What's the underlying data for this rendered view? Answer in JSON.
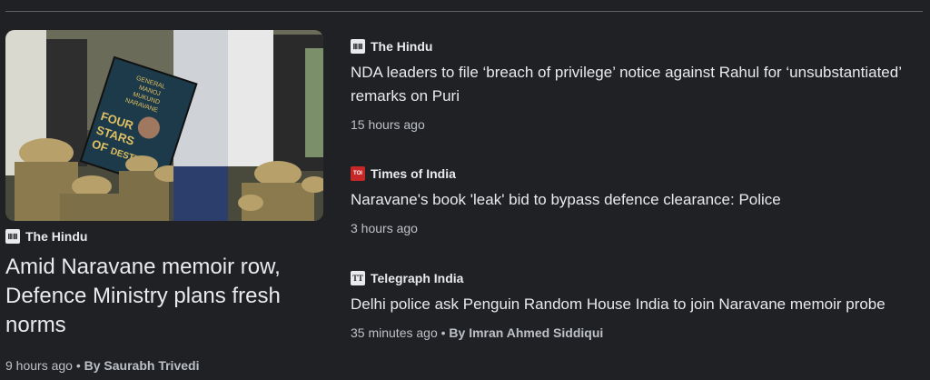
{
  "main_story": {
    "source": "The Hindu",
    "source_icon": "the-hindu-logo-icon",
    "title": "Amid Naravane memoir row, Defence Ministry plans fresh norms",
    "time": "9 hours ago",
    "byline": "By Saurabh Trivedi",
    "image_book_text": [
      "GENERAL",
      "MANOJ",
      "MUKUND",
      "NARAVANE",
      "FOUR",
      "STARS",
      "OF",
      "DESTINY"
    ]
  },
  "side_stories": [
    {
      "source": "The Hindu",
      "source_icon": "the-hindu-logo-icon",
      "title": "NDA leaders to file ‘breach of privilege’ notice against Rahul for ‘unsubstantiated’ remarks on Puri",
      "time": "15 hours ago"
    },
    {
      "source": "Times of India",
      "source_icon": "times-of-india-logo-icon",
      "icon_text": "TOI",
      "title": "Naravane's book 'leak' bid to bypass defence clearance: Police",
      "time": "3 hours ago"
    },
    {
      "source": "Telegraph India",
      "source_icon": "telegraph-india-logo-icon",
      "icon_text": "TT",
      "title": "Delhi police ask Penguin Random House India to join Naravane memoir probe",
      "time": "35 minutes ago",
      "byline": "By Imran Ahmed Siddiqui"
    }
  ],
  "separator": "•",
  "colors": {
    "background": "#202124",
    "text": "#e8eaed",
    "meta": "#bdc1c6",
    "toi_red": "#c62828"
  }
}
